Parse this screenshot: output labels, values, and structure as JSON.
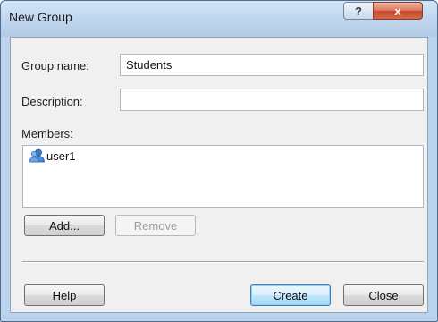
{
  "window": {
    "title": "New Group",
    "help_button": "?",
    "close_button": "x"
  },
  "form": {
    "group_name_label": "Group name:",
    "group_name_value": "Students",
    "description_label": "Description:",
    "description_value": "",
    "members_label": "Members:",
    "members": [
      {
        "name": "user1",
        "icon": "user-icon"
      }
    ]
  },
  "buttons": {
    "add": "Add...",
    "remove": "Remove",
    "help": "Help",
    "create": "Create",
    "close": "Close"
  },
  "colors": {
    "title_bar": "#c0d6ee",
    "close_button": "#c8472a",
    "dialog_body": "#f0f0f0",
    "default_button_border": "#3c7fb1"
  }
}
